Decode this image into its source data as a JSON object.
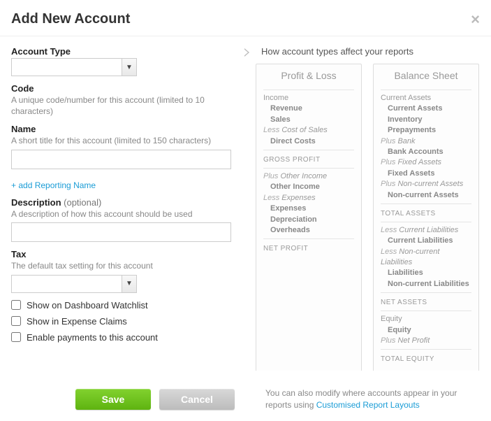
{
  "header": {
    "title": "Add New Account"
  },
  "fields": {
    "account_type": {
      "label": "Account Type"
    },
    "code": {
      "label": "Code",
      "hint": "A unique code/number for this account (limited to 10 characters)"
    },
    "name": {
      "label": "Name",
      "hint": "A short title for this account (limited to 150 characters)"
    },
    "reporting_link": "+ add Reporting Name",
    "description": {
      "label": "Description",
      "optional": "(optional)",
      "hint": "A description of how this account should be used"
    },
    "tax": {
      "label": "Tax",
      "hint": "The default tax setting for this account"
    }
  },
  "checkboxes": {
    "dashboard": "Show on Dashboard Watchlist",
    "expense": "Show in Expense Claims",
    "payments": "Enable payments to this account"
  },
  "right": {
    "title": "How account types affect your reports",
    "profit_loss": {
      "title": "Profit & Loss",
      "income": "Income",
      "revenue": "Revenue",
      "sales": "Sales",
      "less_cost": "Less Cost of Sales",
      "direct_costs": "Direct Costs",
      "gross_profit": "GROSS PROFIT",
      "plus_other": "Plus Other Income",
      "other_income": "Other Income",
      "less_expenses": "Less Expenses",
      "expenses": "Expenses",
      "depreciation": "Depreciation",
      "overheads": "Overheads",
      "net_profit": "NET PROFIT"
    },
    "balance_sheet": {
      "title": "Balance Sheet",
      "current_assets_h": "Current Assets",
      "current_assets": "Current Assets",
      "inventory": "Inventory",
      "prepayments": "Prepayments",
      "plus_bank": "Plus Bank",
      "bank_accounts": "Bank Accounts",
      "plus_fixed": "Plus Fixed Assets",
      "fixed_assets": "Fixed Assets",
      "plus_noncurrent": "Plus Non-current Assets",
      "noncurrent_assets": "Non-current Assets",
      "total_assets": "TOTAL ASSETS",
      "less_current_liab": "Less Current Liabilities",
      "current_liabilities": "Current Liabilities",
      "less_noncurrent_liab": "Less Non-current Liabilities",
      "liabilities": "Liabilities",
      "noncurrent_liabilities": "Non-current Liabilities",
      "net_assets": "NET ASSETS",
      "equity_h": "Equity",
      "equity": "Equity",
      "plus_net_profit": "Plus Net Profit",
      "total_equity": "TOTAL EQUITY"
    }
  },
  "footer": {
    "note_before": "You can also modify where accounts appear in your reports using ",
    "note_link": "Customised Report Layouts",
    "save": "Save",
    "cancel": "Cancel"
  }
}
